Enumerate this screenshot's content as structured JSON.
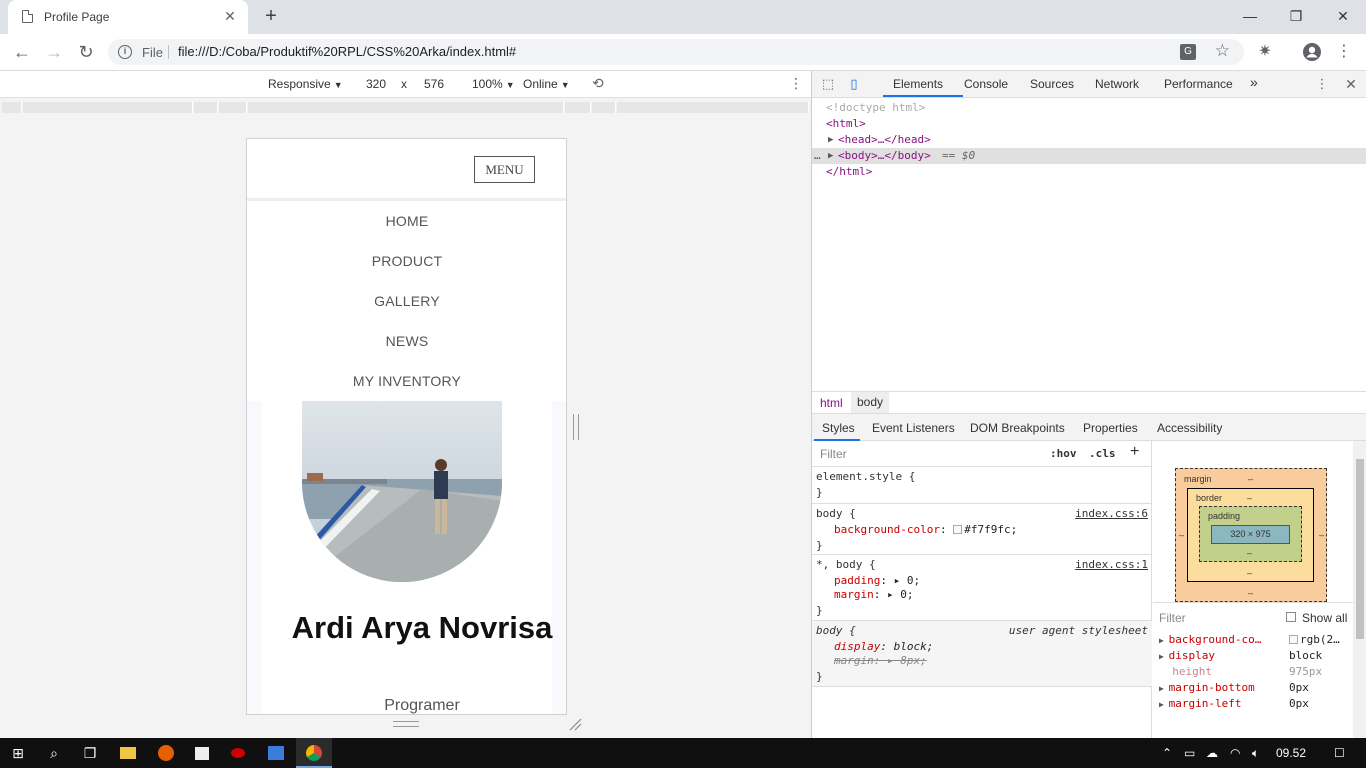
{
  "browser": {
    "tab_title": "Profile Page",
    "tab_close": "✕",
    "new_tab": "+",
    "window": {
      "minimize": "—",
      "maximize": "❐",
      "close": "✕"
    },
    "nav": {
      "back": "←",
      "forward": "→",
      "reload": "↻"
    },
    "omnibox": {
      "info": "i",
      "protocol": "File",
      "url": "file:///D:/Coba/Produktif%20RPL/CSS%20Arka/index.html#"
    }
  },
  "device_toolbar": {
    "mode": "Responsive",
    "width": "320",
    "times": "x",
    "height": "576",
    "zoom": "100%",
    "network": "Online",
    "caret": "▼"
  },
  "site": {
    "menu_button": "MENU",
    "nav": [
      "HOME",
      "PRODUCT",
      "GALLERY",
      "NEWS",
      "MY INVENTORY"
    ],
    "name": "Ardi Arya Novrisa",
    "role": "Programer"
  },
  "devtools": {
    "tabs": [
      "Elements",
      "Console",
      "Sources",
      "Network",
      "Performance"
    ],
    "more": "»",
    "dom": {
      "doctype": "<!doctype html>",
      "html_open": "<html>",
      "head": "<head>…</head>",
      "body": "<body>…</body>",
      "body_marker": "== $0",
      "html_close": "</html>"
    },
    "breadcrumbs": [
      "html",
      "body"
    ],
    "subtabs": [
      "Styles",
      "Event Listeners",
      "DOM Breakpoints",
      "Properties",
      "Accessibility"
    ],
    "styles": {
      "filter_placeholder": "Filter",
      "hov": ":hov",
      "cls": ".cls",
      "plus": "+",
      "rules": {
        "element_style": "element.style {",
        "close": "}",
        "body_selector": "body {",
        "body_source": "index.css:6",
        "bg_prop": "background-color",
        "bg_val": "#f7f9fc;",
        "universal_selector": "*, body {",
        "universal_source": "index.css:1",
        "padding_prop": "padding",
        "padding_val": "0;",
        "margin_prop": "margin",
        "margin_val": "0;",
        "ua_selector": "body {",
        "ua_source": "user agent stylesheet",
        "display_prop": "display",
        "display_val": "block;",
        "ua_margin_prop": "margin",
        "ua_margin_val": "8px;"
      }
    },
    "box_model": {
      "margin_label": "margin",
      "border_label": "border",
      "padding_label": "padding",
      "dash": "–",
      "content_size": "320 × 975"
    },
    "computed": {
      "filter_placeholder": "Filter",
      "show_all": "Show all",
      "props": [
        {
          "name": "background-co…",
          "value": "rgb(2…"
        },
        {
          "name": "display",
          "value": "block"
        },
        {
          "name": "height",
          "value": "975px"
        },
        {
          "name": "margin-bottom",
          "value": "0px"
        },
        {
          "name": "margin-left",
          "value": "0px"
        }
      ]
    }
  },
  "taskbar": {
    "start": "⊞",
    "search": "⌕",
    "task_view": "❐",
    "time": "09.52",
    "notification": "☐"
  }
}
